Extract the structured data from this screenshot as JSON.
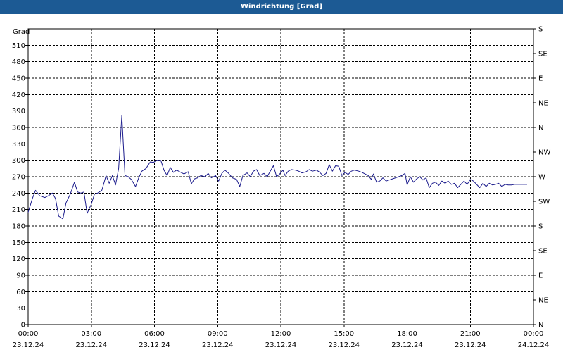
{
  "window": {
    "title": "Windrichtung [Grad]"
  },
  "chart_data": {
    "type": "line",
    "title": "Windrichtung [Grad]",
    "ylabel": "Grad",
    "xlabel": "",
    "ylim": [
      0,
      540
    ],
    "y_ticks": [
      0,
      30,
      60,
      90,
      120,
      150,
      180,
      210,
      240,
      270,
      300,
      330,
      360,
      390,
      420,
      450,
      480,
      510
    ],
    "y_right_ticks": [
      {
        "value": 0,
        "label": "N"
      },
      {
        "value": 45,
        "label": "NE"
      },
      {
        "value": 90,
        "label": "E"
      },
      {
        "value": 135,
        "label": "SE"
      },
      {
        "value": 180,
        "label": "S"
      },
      {
        "value": 225,
        "label": "SW"
      },
      {
        "value": 270,
        "label": "W"
      },
      {
        "value": 315,
        "label": "NW"
      },
      {
        "value": 360,
        "label": "N"
      },
      {
        "value": 405,
        "label": "NE"
      },
      {
        "value": 450,
        "label": "E"
      },
      {
        "value": 495,
        "label": "SE"
      },
      {
        "value": 540,
        "label": "S"
      }
    ],
    "xlim": [
      0,
      24
    ],
    "x_ticks": [
      {
        "value": 0,
        "time": "00:00",
        "date": "23.12.24"
      },
      {
        "value": 3,
        "time": "03:00",
        "date": "23.12.24"
      },
      {
        "value": 6,
        "time": "06:00",
        "date": "23.12.24"
      },
      {
        "value": 9,
        "time": "09:00",
        "date": "23.12.24"
      },
      {
        "value": 12,
        "time": "12:00",
        "date": "23.12.24"
      },
      {
        "value": 15,
        "time": "15:00",
        "date": "23.12.24"
      },
      {
        "value": 18,
        "time": "18:00",
        "date": "23.12.24"
      },
      {
        "value": 21,
        "time": "21:00",
        "date": "23.12.24"
      },
      {
        "value": 24,
        "time": "00:00",
        "date": "24.12.24"
      }
    ],
    "grid": true,
    "line_color": "#1a1a8c",
    "series": [
      {
        "points": [
          [
            0.0,
            205
          ],
          [
            0.2,
            230
          ],
          [
            0.35,
            245
          ],
          [
            0.55,
            235
          ],
          [
            0.8,
            232
          ],
          [
            1.0,
            236
          ],
          [
            1.15,
            240
          ],
          [
            1.3,
            230
          ],
          [
            1.45,
            198
          ],
          [
            1.65,
            193
          ],
          [
            1.8,
            222
          ],
          [
            2.0,
            238
          ],
          [
            2.2,
            260
          ],
          [
            2.35,
            242
          ],
          [
            2.5,
            240
          ],
          [
            2.65,
            242
          ],
          [
            2.8,
            203
          ],
          [
            3.0,
            220
          ],
          [
            3.15,
            238
          ],
          [
            3.3,
            240
          ],
          [
            3.5,
            245
          ],
          [
            3.7,
            272
          ],
          [
            3.85,
            258
          ],
          [
            4.0,
            272
          ],
          [
            4.15,
            255
          ],
          [
            4.3,
            285
          ],
          [
            4.45,
            382
          ],
          [
            4.6,
            272
          ],
          [
            4.75,
            270
          ],
          [
            4.9,
            265
          ],
          [
            5.1,
            252
          ],
          [
            5.25,
            268
          ],
          [
            5.4,
            280
          ],
          [
            5.6,
            285
          ],
          [
            5.8,
            297
          ],
          [
            5.95,
            296
          ],
          [
            6.1,
            300
          ],
          [
            6.3,
            300
          ],
          [
            6.45,
            282
          ],
          [
            6.6,
            272
          ],
          [
            6.75,
            287
          ],
          [
            6.9,
            278
          ],
          [
            7.05,
            282
          ],
          [
            7.25,
            278
          ],
          [
            7.4,
            275
          ],
          [
            7.6,
            279
          ],
          [
            7.75,
            257
          ],
          [
            7.9,
            266
          ],
          [
            8.05,
            268
          ],
          [
            8.2,
            272
          ],
          [
            8.4,
            270
          ],
          [
            8.55,
            276
          ],
          [
            8.7,
            268
          ],
          [
            8.9,
            272
          ],
          [
            9.05,
            262
          ],
          [
            9.2,
            276
          ],
          [
            9.35,
            282
          ],
          [
            9.5,
            277
          ],
          [
            9.7,
            268
          ],
          [
            9.9,
            265
          ],
          [
            10.05,
            252
          ],
          [
            10.2,
            272
          ],
          [
            10.4,
            277
          ],
          [
            10.55,
            270
          ],
          [
            10.7,
            280
          ],
          [
            10.85,
            283
          ],
          [
            11.0,
            272
          ],
          [
            11.2,
            276
          ],
          [
            11.35,
            270
          ],
          [
            11.5,
            280
          ],
          [
            11.65,
            290
          ],
          [
            11.8,
            270
          ],
          [
            11.95,
            275
          ],
          [
            12.1,
            282
          ],
          [
            12.2,
            272
          ],
          [
            12.35,
            280
          ],
          [
            12.5,
            283
          ],
          [
            12.7,
            282
          ],
          [
            12.85,
            280
          ],
          [
            13.0,
            277
          ],
          [
            13.2,
            279
          ],
          [
            13.35,
            283
          ],
          [
            13.5,
            280
          ],
          [
            13.7,
            282
          ],
          [
            13.85,
            278
          ],
          [
            14.0,
            272
          ],
          [
            14.15,
            276
          ],
          [
            14.3,
            292
          ],
          [
            14.45,
            280
          ],
          [
            14.6,
            290
          ],
          [
            14.75,
            289
          ],
          [
            14.9,
            272
          ],
          [
            15.05,
            278
          ],
          [
            15.2,
            274
          ],
          [
            15.35,
            280
          ],
          [
            15.5,
            282
          ],
          [
            15.7,
            280
          ],
          [
            15.85,
            278
          ],
          [
            16.0,
            275
          ],
          [
            16.15,
            272
          ],
          [
            16.3,
            265
          ],
          [
            16.4,
            275
          ],
          [
            16.55,
            260
          ],
          [
            16.7,
            262
          ],
          [
            16.85,
            268
          ],
          [
            17.0,
            262
          ],
          [
            17.15,
            264
          ],
          [
            17.3,
            266
          ],
          [
            17.45,
            268
          ],
          [
            17.6,
            270
          ],
          [
            17.75,
            272
          ],
          [
            17.9,
            276
          ],
          [
            18.0,
            255
          ],
          [
            18.15,
            270
          ],
          [
            18.3,
            260
          ],
          [
            18.45,
            266
          ],
          [
            18.6,
            270
          ],
          [
            18.75,
            264
          ],
          [
            18.9,
            268
          ],
          [
            19.05,
            250
          ],
          [
            19.2,
            258
          ],
          [
            19.35,
            260
          ],
          [
            19.5,
            254
          ],
          [
            19.65,
            262
          ],
          [
            19.8,
            258
          ],
          [
            19.95,
            262
          ],
          [
            20.1,
            256
          ],
          [
            20.25,
            258
          ],
          [
            20.4,
            250
          ],
          [
            20.55,
            256
          ],
          [
            20.7,
            262
          ],
          [
            20.85,
            256
          ],
          [
            21.0,
            265
          ],
          [
            21.15,
            262
          ],
          [
            21.3,
            256
          ],
          [
            21.45,
            250
          ],
          [
            21.6,
            258
          ],
          [
            21.75,
            252
          ],
          [
            21.9,
            258
          ],
          [
            22.05,
            255
          ],
          [
            22.2,
            256
          ],
          [
            22.35,
            258
          ],
          [
            22.5,
            252
          ],
          [
            22.65,
            256
          ],
          [
            22.8,
            255
          ],
          [
            22.95,
            255
          ],
          [
            23.1,
            256
          ],
          [
            23.3,
            256
          ],
          [
            23.5,
            256
          ],
          [
            23.7,
            256
          ]
        ]
      }
    ]
  }
}
